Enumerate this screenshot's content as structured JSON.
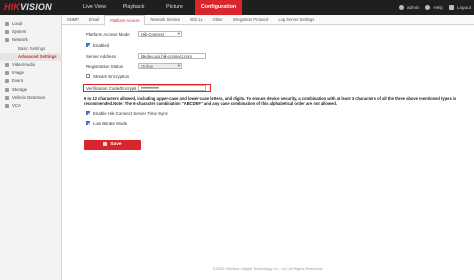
{
  "brand": {
    "logo": "HIKVISION"
  },
  "topnav": {
    "items": [
      {
        "label": "Live View"
      },
      {
        "label": "Playback"
      },
      {
        "label": "Picture"
      },
      {
        "label": "Configuration",
        "active": true
      }
    ]
  },
  "user": {
    "name": "admin",
    "help": "Help",
    "logout": "Logout"
  },
  "sidebar": {
    "items": [
      {
        "label": "Local",
        "icon": "monitor-icon"
      },
      {
        "label": "System",
        "icon": "system-icon"
      },
      {
        "label": "Network",
        "icon": "network-icon"
      },
      {
        "label": "Basic Settings",
        "sub": true
      },
      {
        "label": "Advanced Settings",
        "sub": true,
        "active": true
      },
      {
        "label": "Video/Audio",
        "icon": "video-icon"
      },
      {
        "label": "Image",
        "icon": "image-icon"
      },
      {
        "label": "Event",
        "icon": "event-icon"
      },
      {
        "label": "Storage",
        "icon": "storage-icon"
      },
      {
        "label": "Vehicle Detection",
        "icon": "vehicle-icon"
      },
      {
        "label": "VCA",
        "icon": "vca-icon"
      }
    ]
  },
  "tabs": [
    {
      "label": "SNMP"
    },
    {
      "label": "Email"
    },
    {
      "label": "Platform Access",
      "active": true
    },
    {
      "label": "Network Service"
    },
    {
      "label": "802.1x"
    },
    {
      "label": "Other"
    },
    {
      "label": "Integration Protocol"
    },
    {
      "label": "Log Server Settings"
    }
  ],
  "form": {
    "platform_access_mode_label": "Platform Access Mode",
    "platform_access_mode_value": "Hik-Connect",
    "enabled_label": "Enabled",
    "server_address_label": "Server Address",
    "server_address_value": "litedev.xxx.hik-connect.com",
    "registration_status_label": "Registration Status",
    "registration_status_value": "Online",
    "stream_encryption_label": "Stream Encryption",
    "verification_label": "Verification Code/Encrypti...",
    "verification_value": "●●●●●●●●●",
    "info_text": "6 to 12 characters allowed, including upper-case and lower-case letters, and digits. To ensure device security, a combination with at least 3 characters of all the three above mentioned types is recommended.Note: The 6-character combination \"ABCDEF\" and any case combination of this alphabetical order are not allowed.",
    "enable_sync_label": "Enable Hik-Connect Server Time Sync",
    "low_bitrate_label": "Low Bitrate Mode",
    "save_label": "Save"
  },
  "checkboxes": {
    "enabled": true,
    "stream_encryption": false,
    "enable_sync": true,
    "low_bitrate": true
  },
  "footer": {
    "copyright": "©2023 Hikvision Digital Technology Co., Ltd. All Rights Reserved."
  },
  "colors": {
    "accent": "#d9262c",
    "topbar": "#1f1f1f",
    "checkbox": "#3b70c8"
  }
}
